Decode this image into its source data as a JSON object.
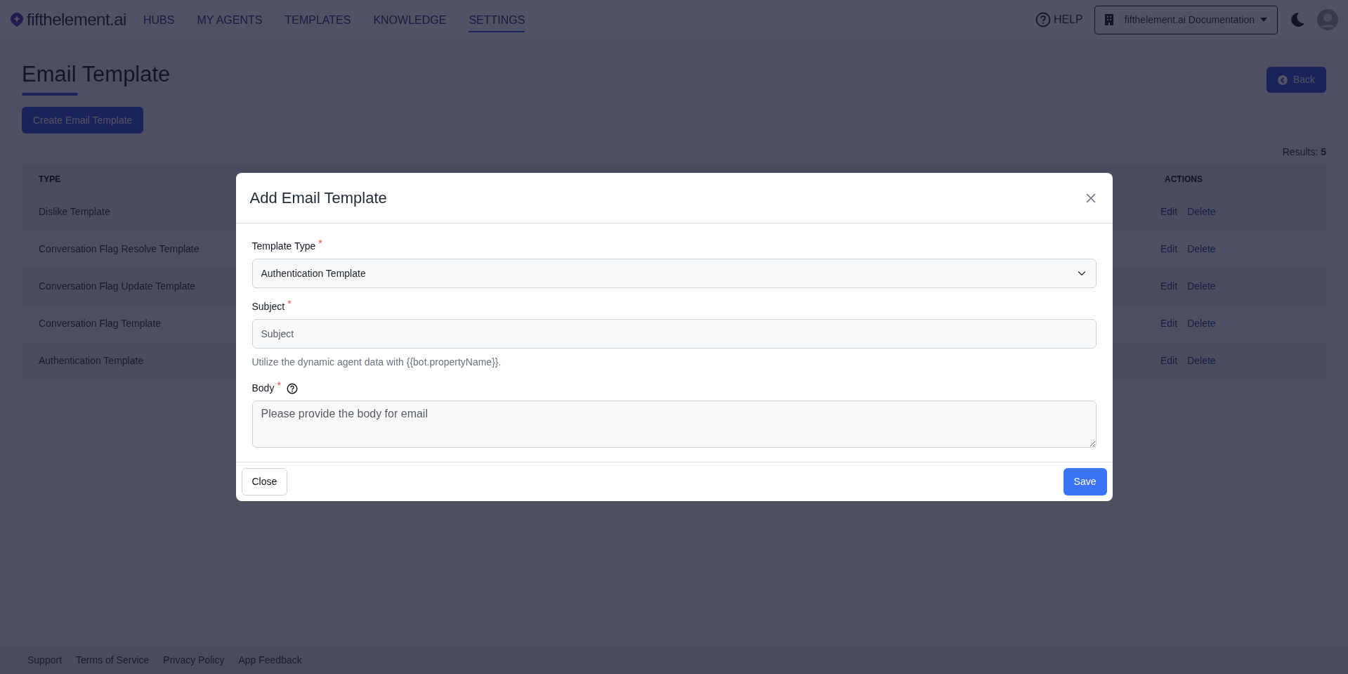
{
  "navbar": {
    "brand": "fifthelement.ai",
    "links": [
      {
        "label": "HUBS",
        "selected": false
      },
      {
        "label": "MY AGENTS",
        "selected": false
      },
      {
        "label": "TEMPLATES",
        "selected": false
      },
      {
        "label": "KNOWLEDGE",
        "selected": false
      },
      {
        "label": "SETTINGS",
        "selected": true
      }
    ],
    "help": "HELP",
    "workspace": "fifthelement.ai Documentation"
  },
  "page": {
    "title": "Email Template",
    "back_button": "Back",
    "create_button": "Create Email Template",
    "results": "Results: **5**"
  },
  "table": {
    "columns": [
      "TYPE",
      "ACTIONS"
    ],
    "rows": [
      {
        "type": "Dislike Template",
        "actions": [
          "Edit",
          "Delete"
        ]
      },
      {
        "type": "Conversation Flag Resolve Template",
        "actions": [
          "Edit",
          "Delete"
        ]
      },
      {
        "type": "Conversation Flag Update Template",
        "actions": [
          "Edit",
          "Delete"
        ]
      },
      {
        "type": "Conversation Flag Template",
        "actions": [
          "Edit",
          "Delete"
        ]
      },
      {
        "type": "Authentication Template",
        "actions": [
          "Edit",
          "Delete"
        ]
      }
    ]
  },
  "modal": {
    "title": "Add Email Template",
    "fields": [
      {
        "kind": "select",
        "label": "Template Type",
        "required_mark": "*",
        "value": "Authentication Template"
      },
      {
        "kind": "input",
        "label": "Subject",
        "required_mark": "*",
        "placeholder": "Subject",
        "hint": "Utilize the dynamic agent data with {{bot.propertyName}}."
      },
      {
        "kind": "textarea",
        "label": "Body",
        "required_mark": "*",
        "help_icon": true,
        "placeholder": "Please provide the body for email"
      }
    ],
    "buttons": [
      {
        "kind": "secondary",
        "label": "Close"
      },
      {
        "kind": "primary",
        "label": "Save"
      }
    ]
  },
  "footer": {
    "links": [
      "Support",
      "Terms of Service",
      "Privacy Policy",
      "App Feedback"
    ]
  }
}
